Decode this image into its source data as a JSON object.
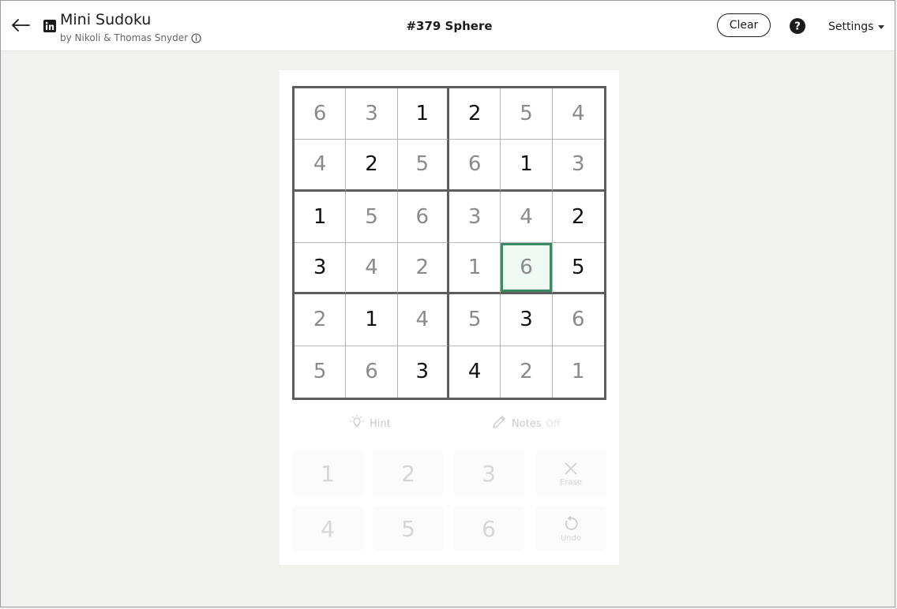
{
  "header": {
    "title": "Mini Sudoku",
    "byline": "by Nikoli & Thomas Snyder",
    "puzzle_id": "#379 Sphere",
    "clear_label": "Clear",
    "settings_label": "Settings"
  },
  "board": {
    "selected": [
      3,
      4
    ],
    "rows": [
      [
        {
          "v": "6",
          "t": "user"
        },
        {
          "v": "3",
          "t": "user"
        },
        {
          "v": "1",
          "t": "given"
        },
        {
          "v": "2",
          "t": "given"
        },
        {
          "v": "5",
          "t": "user"
        },
        {
          "v": "4",
          "t": "user"
        }
      ],
      [
        {
          "v": "4",
          "t": "user"
        },
        {
          "v": "2",
          "t": "given"
        },
        {
          "v": "5",
          "t": "user"
        },
        {
          "v": "6",
          "t": "user"
        },
        {
          "v": "1",
          "t": "given"
        },
        {
          "v": "3",
          "t": "user"
        }
      ],
      [
        {
          "v": "1",
          "t": "given"
        },
        {
          "v": "5",
          "t": "user"
        },
        {
          "v": "6",
          "t": "user"
        },
        {
          "v": "3",
          "t": "user"
        },
        {
          "v": "4",
          "t": "user"
        },
        {
          "v": "2",
          "t": "given"
        }
      ],
      [
        {
          "v": "3",
          "t": "given"
        },
        {
          "v": "4",
          "t": "user"
        },
        {
          "v": "2",
          "t": "user"
        },
        {
          "v": "1",
          "t": "user"
        },
        {
          "v": "6",
          "t": "user"
        },
        {
          "v": "5",
          "t": "given"
        }
      ],
      [
        {
          "v": "2",
          "t": "user"
        },
        {
          "v": "1",
          "t": "given"
        },
        {
          "v": "4",
          "t": "user"
        },
        {
          "v": "5",
          "t": "user"
        },
        {
          "v": "3",
          "t": "given"
        },
        {
          "v": "6",
          "t": "user"
        }
      ],
      [
        {
          "v": "5",
          "t": "user"
        },
        {
          "v": "6",
          "t": "user"
        },
        {
          "v": "3",
          "t": "given"
        },
        {
          "v": "4",
          "t": "given"
        },
        {
          "v": "2",
          "t": "user"
        },
        {
          "v": "1",
          "t": "user"
        }
      ]
    ]
  },
  "tools": {
    "hint_label": "Hint",
    "notes_label": "Notes",
    "notes_state": "Off"
  },
  "keypad": {
    "digits": [
      "1",
      "2",
      "3",
      "4",
      "5",
      "6"
    ],
    "erase_label": "Erase",
    "undo_label": "Undo"
  },
  "colors": {
    "selected_border": "#3c8a62",
    "selected_fill": "#eefaf1",
    "grid_line": "#5d5d5d",
    "background": "#f3f1ee"
  }
}
